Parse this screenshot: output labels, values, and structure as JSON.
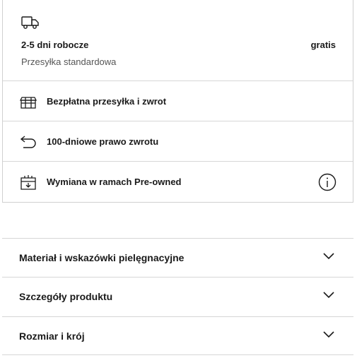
{
  "shipping": {
    "icon": "truck-icon",
    "title": "2-5 dni robocze",
    "price": "gratis",
    "subtitle": "Przesyłka standardowa"
  },
  "features": [
    {
      "icon": "box-icon",
      "label": "Bezpłatna przesyłka i zwrot"
    },
    {
      "icon": "return-arrow-icon",
      "label": "100-dniowe prawo zwrotu"
    },
    {
      "icon": "preowned-box-icon",
      "label": "Wymiana w ramach Pre-owned",
      "info_icon": "info-icon"
    }
  ],
  "accordion": [
    {
      "label": "Materiał i wskazówki pielęgnacyjne",
      "icon": "chevron-down-icon"
    },
    {
      "label": "Szczegóły produktu",
      "icon": "chevron-down-icon"
    },
    {
      "label": "Rozmiar i krój",
      "icon": "chevron-down-icon"
    }
  ]
}
